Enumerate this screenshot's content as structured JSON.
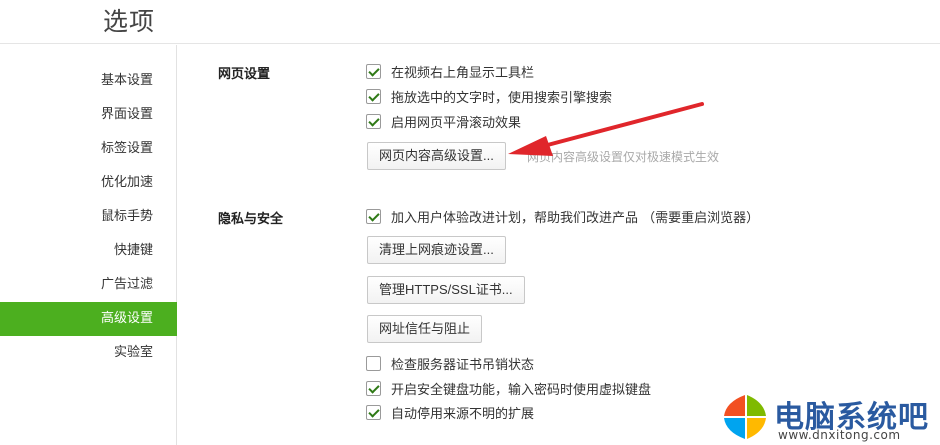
{
  "header": {
    "title": "选项"
  },
  "sidebar": {
    "items": [
      {
        "label": "基本设置",
        "active": false
      },
      {
        "label": "界面设置",
        "active": false
      },
      {
        "label": "标签设置",
        "active": false
      },
      {
        "label": "优化加速",
        "active": false
      },
      {
        "label": "鼠标手势",
        "active": false
      },
      {
        "label": "快捷键",
        "active": false
      },
      {
        "label": "广告过滤",
        "active": false
      },
      {
        "label": "高级设置",
        "active": true
      },
      {
        "label": "实验室",
        "active": false
      }
    ]
  },
  "web_settings": {
    "title": "网页设置",
    "options": [
      {
        "label": "在视频右上角显示工具栏",
        "checked": true
      },
      {
        "label": "拖放选中的文字时，使用搜索引擎搜索",
        "checked": true
      },
      {
        "label": "启用网页平滑滚动效果",
        "checked": true
      }
    ],
    "advanced_button": "网页内容高级设置...",
    "advanced_hint": "网页内容高级设置仅对极速模式生效"
  },
  "privacy": {
    "title": "隐私与安全",
    "join_program": {
      "label": "加入用户体验改进计划，帮助我们改进产品 （需要重启浏览器）",
      "checked": true
    },
    "clear_traces_button": "清理上网痕迹设置...",
    "manage_certs_button": "管理HTTPS/SSL证书...",
    "trust_block_button": "网址信任与阻止",
    "options": [
      {
        "label": "检查服务器证书吊销状态",
        "checked": false
      },
      {
        "label": "开启安全键盘功能，输入密码时使用虚拟键盘",
        "checked": true
      },
      {
        "label": "自动停用来源不明的扩展",
        "checked": true
      }
    ]
  },
  "watermark": {
    "text": "电脑系统吧",
    "url": "www.dnxitong.com"
  },
  "colors": {
    "accent": "#4caf1f",
    "arrow": "#e0262b",
    "watermark_text": "#2a5aa0"
  }
}
